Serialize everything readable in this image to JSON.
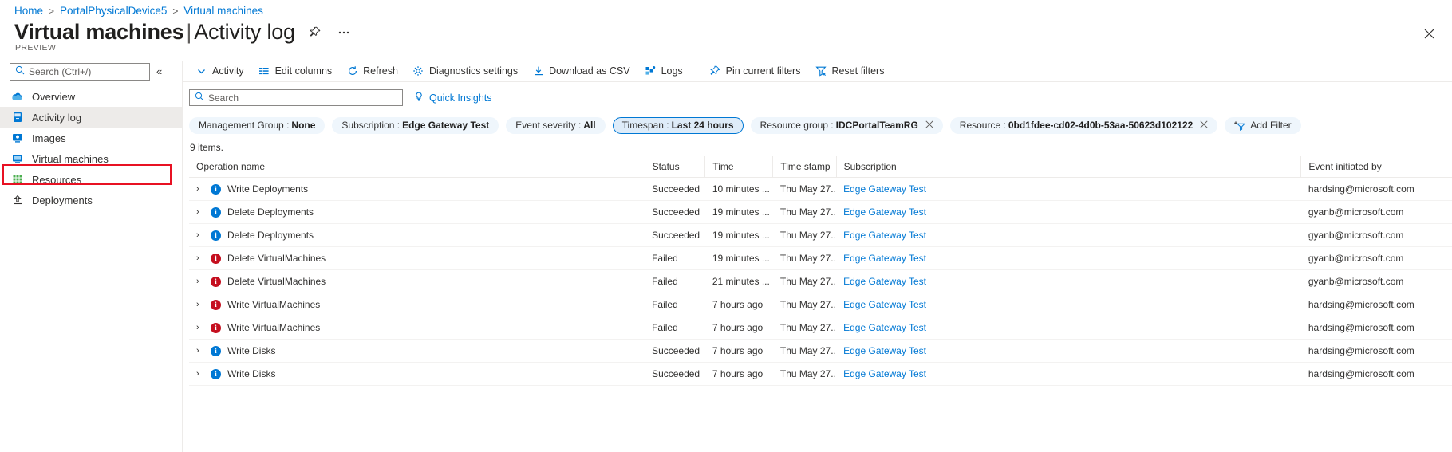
{
  "breadcrumb": {
    "items": [
      "Home",
      "PortalPhysicalDevice5",
      "Virtual machines"
    ],
    "separator": ">"
  },
  "header": {
    "title_main": "Virtual machines",
    "title_sep": "|",
    "title_sub": "Activity log",
    "preview_label": "PREVIEW",
    "pin_icon": "pin-icon",
    "more_icon": "ellipsis-icon",
    "close_icon": "close-icon"
  },
  "sidebar": {
    "search_placeholder": "Search (Ctrl+/)",
    "search_value": "",
    "search_icon": "search-icon",
    "collapse_icon": "chevron-double-left-icon",
    "items": [
      {
        "label": "Overview",
        "icon": "cloud-icon",
        "selected": false
      },
      {
        "label": "Activity log",
        "icon": "activity-log-icon",
        "selected": true
      },
      {
        "label": "Images",
        "icon": "image-icon",
        "selected": false
      },
      {
        "label": "Virtual machines",
        "icon": "vm-icon",
        "selected": false
      },
      {
        "label": "Resources",
        "icon": "grid-icon",
        "selected": false
      },
      {
        "label": "Deployments",
        "icon": "deployments-icon",
        "selected": false
      }
    ],
    "highlight_color": "#e81123"
  },
  "toolbar": {
    "commands": [
      {
        "label": "Activity",
        "icon": "chevron-down-icon"
      },
      {
        "label": "Edit columns",
        "icon": "columns-icon"
      },
      {
        "label": "Refresh",
        "icon": "refresh-icon"
      },
      {
        "label": "Diagnostics settings",
        "icon": "gear-icon"
      },
      {
        "label": "Download as CSV",
        "icon": "download-icon"
      },
      {
        "label": "Logs",
        "icon": "logs-icon"
      }
    ],
    "commands_after_sep": [
      {
        "label": "Pin current filters",
        "icon": "pin-icon"
      },
      {
        "label": "Reset filters",
        "icon": "filter-reset-icon"
      }
    ]
  },
  "filterbar": {
    "search_placeholder": "Search",
    "search_value": "",
    "search_icon": "search-icon",
    "quick_insights_label": "Quick Insights",
    "quick_insights_icon": "lightbulb-icon"
  },
  "pills": [
    {
      "key": "Management Group :",
      "value": "None",
      "active": false,
      "dismissible": false
    },
    {
      "key": "Subscription :",
      "value": "Edge Gateway Test",
      "active": false,
      "dismissible": false
    },
    {
      "key": "Event severity :",
      "value": "All",
      "active": false,
      "dismissible": false
    },
    {
      "key": "Timespan :",
      "value": "Last 24 hours",
      "active": true,
      "dismissible": false
    },
    {
      "key": "Resource group :",
      "value": "IDCPortalTeamRG",
      "active": false,
      "dismissible": true
    },
    {
      "key": "Resource :",
      "value": "0bd1fdee-cd02-4d0b-53aa-50623d102122",
      "active": false,
      "dismissible": true
    }
  ],
  "add_filter": {
    "label": "Add Filter",
    "icon": "add-filter-icon"
  },
  "table": {
    "items_count_label": "9 items.",
    "columns": [
      "Operation name",
      "Status",
      "Time",
      "Time stamp",
      "Subscription",
      "Event initiated by"
    ],
    "rows": [
      {
        "operation": "Write Deployments",
        "severity": "info",
        "status": "Succeeded",
        "time": "10 minutes ...",
        "timestamp": "Thu May 27...",
        "subscription": "Edge Gateway Test",
        "initiated_by": "hardsing@microsoft.com"
      },
      {
        "operation": "Delete Deployments",
        "severity": "info",
        "status": "Succeeded",
        "time": "19 minutes ...",
        "timestamp": "Thu May 27...",
        "subscription": "Edge Gateway Test",
        "initiated_by": "gyanb@microsoft.com"
      },
      {
        "operation": "Delete Deployments",
        "severity": "info",
        "status": "Succeeded",
        "time": "19 minutes ...",
        "timestamp": "Thu May 27...",
        "subscription": "Edge Gateway Test",
        "initiated_by": "gyanb@microsoft.com"
      },
      {
        "operation": "Delete VirtualMachines",
        "severity": "error",
        "status": "Failed",
        "time": "19 minutes ...",
        "timestamp": "Thu May 27...",
        "subscription": "Edge Gateway Test",
        "initiated_by": "gyanb@microsoft.com"
      },
      {
        "operation": "Delete VirtualMachines",
        "severity": "error",
        "status": "Failed",
        "time": "21 minutes ...",
        "timestamp": "Thu May 27...",
        "subscription": "Edge Gateway Test",
        "initiated_by": "gyanb@microsoft.com"
      },
      {
        "operation": "Write VirtualMachines",
        "severity": "error",
        "status": "Failed",
        "time": "7 hours ago",
        "timestamp": "Thu May 27...",
        "subscription": "Edge Gateway Test",
        "initiated_by": "hardsing@microsoft.com"
      },
      {
        "operation": "Write VirtualMachines",
        "severity": "error",
        "status": "Failed",
        "time": "7 hours ago",
        "timestamp": "Thu May 27...",
        "subscription": "Edge Gateway Test",
        "initiated_by": "hardsing@microsoft.com"
      },
      {
        "operation": "Write Disks",
        "severity": "info",
        "status": "Succeeded",
        "time": "7 hours ago",
        "timestamp": "Thu May 27...",
        "subscription": "Edge Gateway Test",
        "initiated_by": "hardsing@microsoft.com"
      },
      {
        "operation": "Write Disks",
        "severity": "info",
        "status": "Succeeded",
        "time": "7 hours ago",
        "timestamp": "Thu May 27...",
        "subscription": "Edge Gateway Test",
        "initiated_by": "hardsing@microsoft.com"
      }
    ],
    "expand_icon": "chevron-right-icon"
  },
  "colors": {
    "link": "#0078d4",
    "info": "#0078d4",
    "error": "#c50f1f",
    "pill_bg": "#eff6fc",
    "pill_active_bg": "#deecf9"
  }
}
